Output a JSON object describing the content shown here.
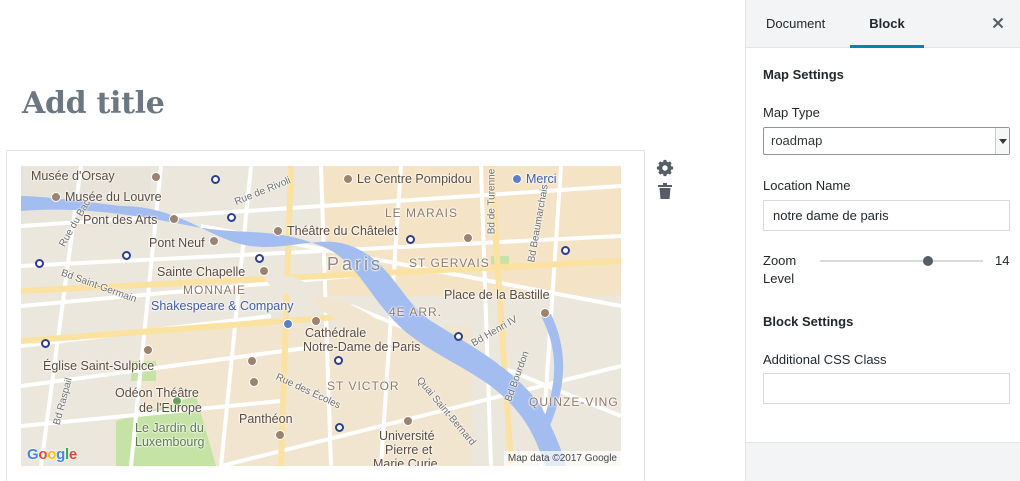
{
  "editor": {
    "title_placeholder": "Add title"
  },
  "map": {
    "labels": {
      "musee_orsay": "Musée d'Orsay",
      "musee_louvre": "Musée du Louvre",
      "pont_des_arts": "Pont des Arts",
      "pont_neuf": "Pont Neuf",
      "sainte_chapelle": "Sainte Chapelle",
      "monnaie": "MONNAIE",
      "shakespeare": "Shakespeare & Company",
      "le_centre_pompidou": "Le Centre Pompidou",
      "merci": "Merci",
      "le_marais": "LE MARAIS",
      "theatre_chatelet": "Théâtre du Châtelet",
      "paris": "Paris",
      "st_gervais": "ST GERVAIS",
      "place_bastille": "Place de la Bastille",
      "4e_arr": "4E ARR.",
      "cathedrale": "Cathédrale",
      "notre_dame": "Notre-Dame de Paris",
      "eglise_st_sulpice": "Église Saint-Sulpice",
      "odeon_1": "Odéon Théâtre",
      "odeon_2": "de l'Europe",
      "jardin_1": "Le Jardin du",
      "jardin_2": "Luxembourg",
      "pantheon": "Panthéon",
      "st_victor": "ST VICTOR",
      "universite_1": "Université",
      "universite_2": "Pierre et",
      "universite_3": "Marie Curie",
      "quinze_vingts": "QUINZE-VING",
      "rue_du_bac": "Rue du Bac",
      "bd_saint_germain": "Bd Saint-Germain",
      "rue_de_rivoli": "Rue de Rivoli",
      "bd_de_turenne": "Bd de Turenne",
      "bd_beaumarchais": "Bd Beaumarchais",
      "bd_henri_iv": "Bd Henri IV",
      "bd_bourdon": "Bd Bourdon",
      "rue_des_ecoles": "Rue des Écoles",
      "quai_st_bernard": "Quai Saint-Bernard",
      "bd_raspail": "Bd Raspail"
    },
    "google_logo": [
      "G",
      "o",
      "o",
      "g",
      "l",
      "e"
    ],
    "attribution": "Map data ©2017 Google",
    "colors": {
      "river": "#a3bdf0",
      "park": "#c6e3a6",
      "road": "#ffffff",
      "major_road": "#fbe2a1",
      "land": "#ece7dc"
    }
  },
  "block_tools": {
    "settings_icon": "gear-icon",
    "delete_icon": "trash-icon"
  },
  "sidebar": {
    "tabs": [
      {
        "label": "Document",
        "active": false
      },
      {
        "label": "Block",
        "active": true
      }
    ],
    "close_icon": "close-icon",
    "map_settings_heading": "Map Settings",
    "map_type_label": "Map Type",
    "map_type_value": "roadmap",
    "location_label": "Location Name",
    "location_value": "notre dame de paris",
    "zoom_label_line1": "Zoom",
    "zoom_label_line2": "Level",
    "zoom_value": "14",
    "zoom_min": 0,
    "zoom_max": 18,
    "block_settings_heading": "Block Settings",
    "css_class_label": "Additional CSS Class",
    "css_class_value": "",
    "accent_color": "#0085ba"
  }
}
